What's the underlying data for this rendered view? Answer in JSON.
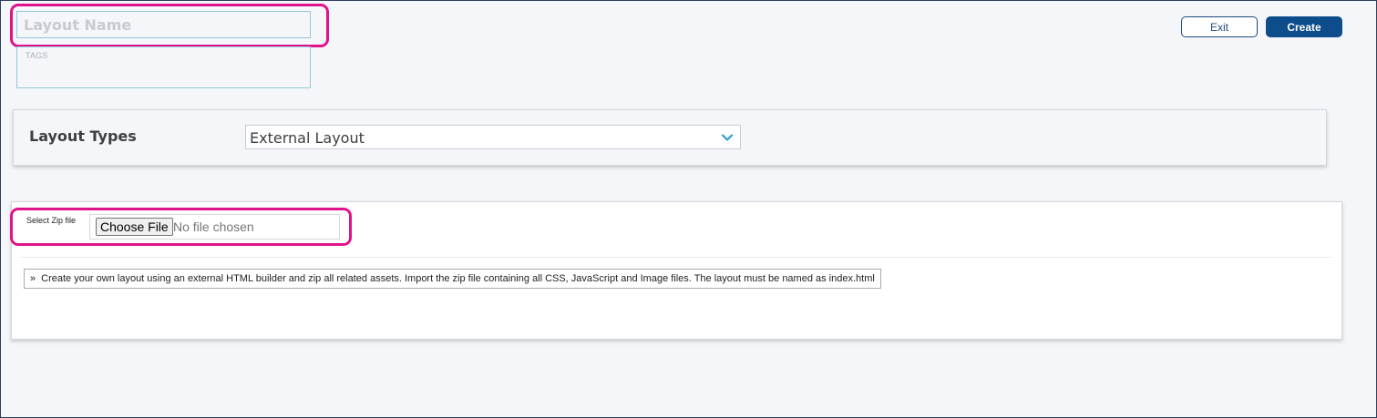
{
  "layout_name": {
    "placeholder": "Layout Name",
    "value": ""
  },
  "tags": {
    "label": "TAGS"
  },
  "toolbar": {
    "exit_label": "Exit",
    "create_label": "Create"
  },
  "layout_types": {
    "label": "Layout Types",
    "selected": "External Layout",
    "icon": "chevron-down-icon"
  },
  "zip": {
    "label": "Select Zip file",
    "choose_label": "Choose File",
    "status": "No file chosen",
    "info_arrow": "»",
    "info_text": "Create your own layout using an external HTML builder and zip all related assets. Import the zip file containing all CSS, JavaScript and Image files. The layout must be named as index.html"
  },
  "colors": {
    "highlight": "#e0138c",
    "primary": "#0d4d8c",
    "input_border": "#8fc9d9",
    "chevron": "#2a9fd6"
  }
}
